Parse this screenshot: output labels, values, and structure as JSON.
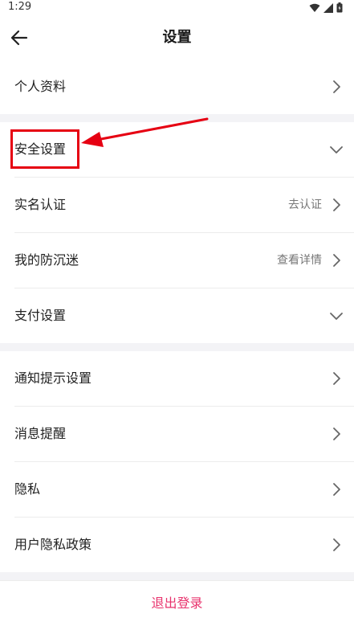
{
  "status_bar": {
    "time": "1:29",
    "icons": [
      "wifi-icon",
      "signal-icon",
      "battery-icon"
    ]
  },
  "header": {
    "title": "设置",
    "back_icon": "back-arrow-icon"
  },
  "groups": [
    {
      "items": [
        {
          "label": "个人资料",
          "value": "",
          "chevron": "right"
        }
      ]
    },
    {
      "items": [
        {
          "label": "安全设置",
          "value": "",
          "chevron": "down"
        },
        {
          "label": "实名认证",
          "value": "去认证",
          "chevron": "right"
        },
        {
          "label": "我的防沉迷",
          "value": "查看详情",
          "chevron": "right"
        },
        {
          "label": "支付设置",
          "value": "",
          "chevron": "down"
        }
      ]
    },
    {
      "items": [
        {
          "label": "通知提示设置",
          "value": "",
          "chevron": "right"
        },
        {
          "label": "消息提醒",
          "value": "",
          "chevron": "right"
        },
        {
          "label": "隐私",
          "value": "",
          "chevron": "right"
        },
        {
          "label": "用户隐私政策",
          "value": "",
          "chevron": "right"
        }
      ]
    }
  ],
  "footer": {
    "logout_label": "退出登录"
  },
  "colors": {
    "accent": "#e8336d",
    "annotation": "#e60012",
    "separator": "#f3f3f6"
  }
}
